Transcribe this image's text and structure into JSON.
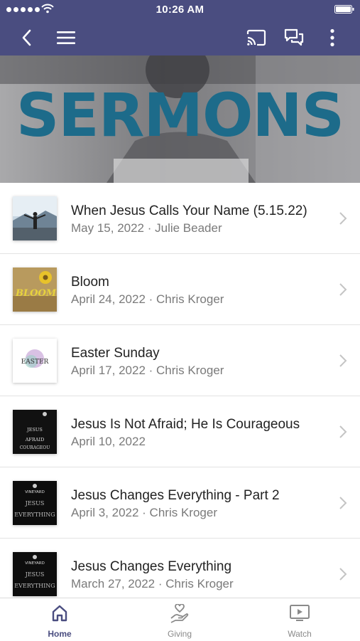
{
  "status_bar": {
    "time": "10:26 AM"
  },
  "app_bar": {
    "back_icon": "chevron-left-icon",
    "menu_icon": "hamburger-menu-icon",
    "cast_icon": "cast-icon",
    "chat_icon": "chat-icon",
    "more_icon": "more-vertical-icon"
  },
  "hero": {
    "title": "SERMONS"
  },
  "sermons": [
    {
      "title": "When Jesus Calls Your Name (5.15.22)",
      "subtitle": "May 15, 2022 · Julie Beader"
    },
    {
      "title": "Bloom",
      "subtitle": "April 24, 2022 · Chris Kroger",
      "thumb_text": "BLOOM"
    },
    {
      "title": "Easter Sunday",
      "subtitle": "April 17, 2022 · Chris Kroger",
      "thumb_text": "EASTER"
    },
    {
      "title": "Jesus Is Not Afraid; He Is Courageous",
      "subtitle": "April 10, 2022",
      "thumb_text": [
        "JESUS",
        "AFRAID",
        "COURAGEOU"
      ]
    },
    {
      "title": "Jesus Changes Everything - Part 2",
      "subtitle": "April 3, 2022 · Chris Kroger",
      "thumb_text": [
        "VINEYARD",
        "JESUS",
        "EVERYTHING"
      ]
    },
    {
      "title": "Jesus Changes Everything",
      "subtitle": "March 27, 2022 · Chris Kroger",
      "thumb_text": [
        "VINEYARD",
        "JESUS",
        "EVERYTHING"
      ]
    }
  ],
  "tabs": [
    {
      "label": "Home",
      "icon": "home-icon",
      "active": true
    },
    {
      "label": "Giving",
      "icon": "giving-hand-heart-icon",
      "active": false
    },
    {
      "label": "Watch",
      "icon": "tv-play-icon",
      "active": false
    }
  ],
  "colors": {
    "header": "#4a4d80",
    "hero_text": "#1d6b8a"
  }
}
